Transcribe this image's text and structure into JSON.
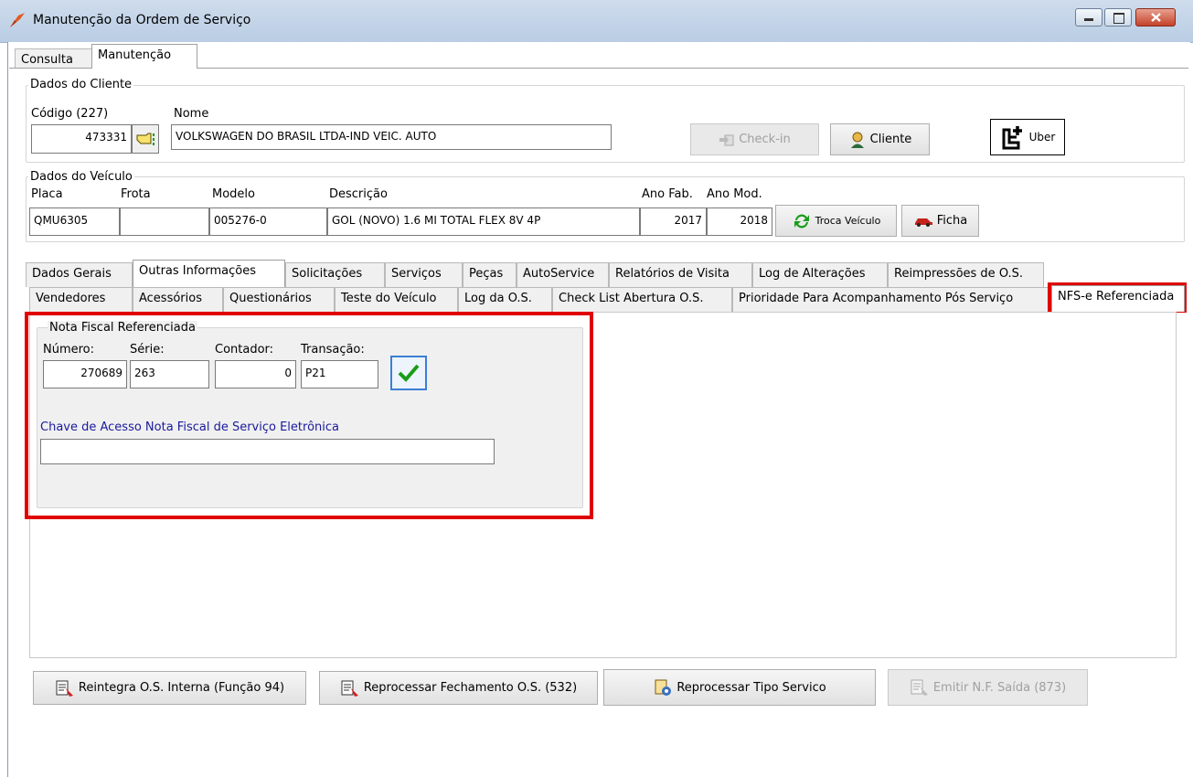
{
  "window": {
    "title": "Manutenção da Ordem de Serviço"
  },
  "main_tabs": [
    "Consulta",
    "Manutenção"
  ],
  "cliente": {
    "group_label": "Dados do Cliente",
    "codigo_label": "Código (227)",
    "codigo_value": "473331",
    "nome_label": "Nome",
    "nome_value": "VOLKSWAGEN DO BRASIL LTDA-IND VEIC. AUTO",
    "checkin_label": "Check-in",
    "cliente_label": "Cliente",
    "uber_label": "Uber"
  },
  "veiculo": {
    "group_label": "Dados do Veículo",
    "placa_label": "Placa",
    "placa_value": "QMU6305",
    "frota_label": "Frota",
    "frota_value": "",
    "modelo_label": "Modelo",
    "modelo_value": "005276-0",
    "descricao_label": "Descrição",
    "descricao_value": "GOL (NOVO) 1.6 MI TOTAL FLEX 8V 4P",
    "ano_fab_label": "Ano Fab.",
    "ano_fab_value": "2017",
    "ano_mod_label": "Ano Mod.",
    "ano_mod_value": "2018",
    "troca_label": "Troca Veículo",
    "ficha_label": "Ficha"
  },
  "tabs_row1": [
    "Dados Gerais",
    "Outras Informações",
    "Solicitações",
    "Serviços",
    "Peças",
    "AutoService",
    "Relatórios de Visita",
    "Log de Alterações",
    "Reimpressões de O.S."
  ],
  "tabs_row2": [
    "Vendedores",
    "Acessórios",
    "Questionários",
    "Teste do Veículo",
    "Log da O.S.",
    "Check List Abertura O.S.",
    "Prioridade Para Acompanhamento Pós Serviço",
    "NFS-e Referenciada"
  ],
  "nf": {
    "group_label": "Nota Fiscal Referenciada",
    "numero_label": "Número:",
    "numero_value": "270689",
    "serie_label": "Série:",
    "serie_value": "263",
    "contador_label": "Contador:",
    "contador_value": "0",
    "transacao_label": "Transação:",
    "transacao_value": "P21",
    "chave_label": "Chave de Acesso Nota Fiscal de Serviço Eletrônica",
    "chave_value": ""
  },
  "bottom_buttons": {
    "reintegra": "Reintegra O.S. Interna (Função 94)",
    "reprocessar_fechamento": "Reprocessar Fechamento O.S. (532)",
    "reprocessar_tipo": "Reprocessar Tipo Servico",
    "emitir_nf": "Emitir N.F. Saída (873)"
  },
  "colors": {
    "highlight": "#e00000",
    "link_blue": "#1a1a9c",
    "check_green": "#1a9c1a"
  }
}
